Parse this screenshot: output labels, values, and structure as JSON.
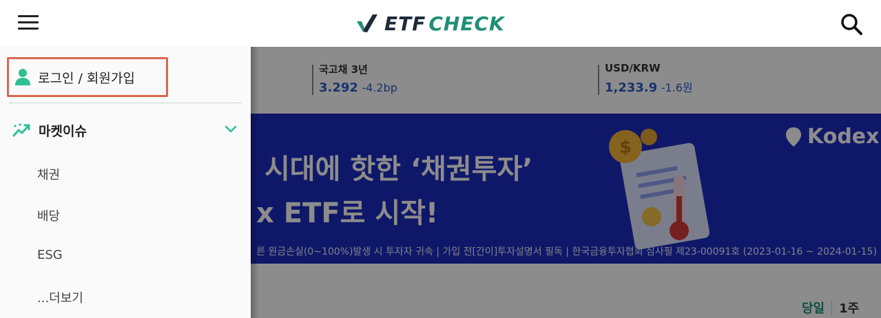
{
  "header": {
    "logo_etf": "ETF",
    "logo_check": "CHECK"
  },
  "tickers": [
    {
      "label": "국고채 3년",
      "value": "3.292",
      "change": "-4.2bp"
    },
    {
      "label": "USD/KRW",
      "value": "1,233.9",
      "change": "-1.6원"
    }
  ],
  "banner": {
    "line1": "시대에 핫한 ‘채권투자’",
    "line2": "x ETF로 시작!",
    "brand": "Kodex",
    "notice": "른 원금손실(0~100%)발생 시 투자자 귀속 | 가입 전[간이]투자설명서 필독 | 한국금융투자협회 심사필 제23-00091호 (2023-01-16 ~ 2024-01-15)"
  },
  "period_tabs": [
    "당일",
    "1주"
  ],
  "drawer": {
    "login_label": "로그인 / 회원가입",
    "section": {
      "title": "마켓이슈",
      "items": [
        "채권",
        "배당",
        "ESG",
        "...더보기"
      ]
    }
  },
  "colors": {
    "accent_green": "#1f8f76",
    "login_highlight": "#d9674f",
    "banner_blue": "#1d2dbd",
    "ticker_blue": "#2a5cc9"
  },
  "icons": [
    "menu-icon",
    "logo-check-icon",
    "search-icon",
    "user-icon",
    "trend-icon",
    "chevron-down-icon"
  ]
}
